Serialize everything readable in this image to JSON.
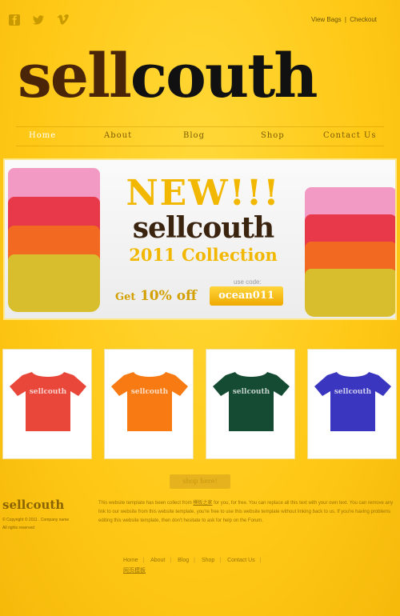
{
  "social": {
    "icons": [
      "facebook-icon",
      "twitter-icon",
      "vimeo-icon"
    ]
  },
  "cart": {
    "view_bags": "View Bags",
    "separator": "|",
    "checkout": "Checkout"
  },
  "logo": {
    "part1": "sell",
    "part2": "couth"
  },
  "nav": {
    "items": [
      "Home",
      "About",
      "Blog",
      "Shop",
      "Contact Us"
    ]
  },
  "banner": {
    "headline1": "NEW!!!",
    "headline2": "sellcouth",
    "headline3": "2011 Collection",
    "use_code_label": "use code:",
    "get": "Get",
    "percent_off": "10% off",
    "code": "ocean011"
  },
  "products": [
    {
      "label": "sellcouth",
      "color": "#e8473a"
    },
    {
      "label": "sellcouth",
      "color": "#f77a12"
    },
    {
      "label": "sellcouth",
      "color": "#144b32"
    },
    {
      "label": "sellcouth",
      "color": "#3a36bf"
    }
  ],
  "shop_button": "shop here!",
  "footer": {
    "logo": "sellcouth",
    "copyright": "© Copyright © 2011 . Company name",
    "rights": "All rights reserved",
    "text_before_link": "This website template has been collect from",
    "link": "模板之家",
    "text_after_link": "for you, for free. You can replace all this text with your own text. You can remove any link to our website from this website template, you're free to use this website template without linking back to us. If you're having problems editing this website template, then don't hesitate to ask for help on the Forum.",
    "nav": [
      "Home",
      "About",
      "Blog",
      "Shop",
      "Contact Us"
    ],
    "nav_extra": "网页模板"
  }
}
